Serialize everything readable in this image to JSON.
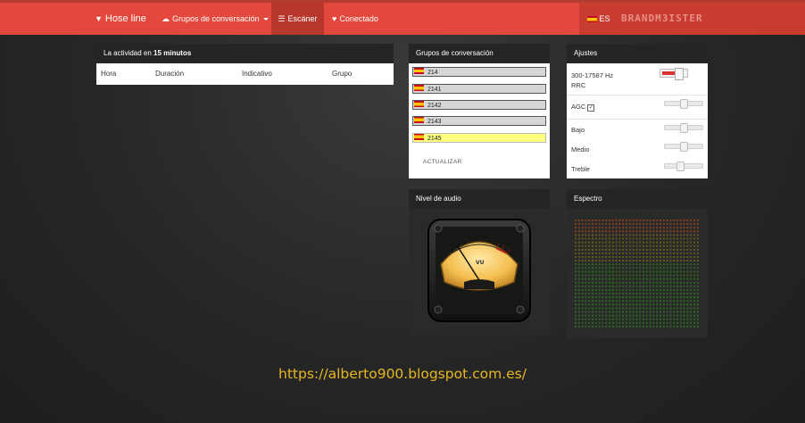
{
  "nav": {
    "brand": "Hose line",
    "groups_menu": "Grupos de conversación",
    "scanner": "Escáner",
    "connected": "Conectado",
    "language": "ES",
    "logo_text": "BRANDM3ISTER",
    "accent_color": "#e2483b",
    "icons": {
      "brand": "wifi-tower-icon",
      "groups": "cloud-icon",
      "scanner": "list-icon",
      "connected": "heart-icon"
    }
  },
  "activity": {
    "title_prefix": "La actividad en ",
    "title_bold": "15 minutos",
    "columns": [
      "Hora",
      "Duración",
      "Indicativo",
      "Grupo"
    ]
  },
  "groups": {
    "title": "Grupos de conversación",
    "items": [
      {
        "id": "214",
        "selected": false
      },
      {
        "id": "2141",
        "selected": false
      },
      {
        "id": "2142",
        "selected": false
      },
      {
        "id": "2143",
        "selected": false
      },
      {
        "id": "2145",
        "selected": true
      }
    ],
    "refresh_label": "ACTUALIZAR"
  },
  "settings": {
    "title": "Ajustes",
    "filter_label": "300-17587 Hz",
    "rrc_label": "RRC",
    "filter_on": true,
    "agc_label": "AGC",
    "agc_checked": true,
    "bass_label": "Bajo",
    "mid_label": "Medio",
    "treble_label": "Treble",
    "levels": {
      "agc": 0.5,
      "bass": 0.5,
      "mid": 0.5,
      "treble": 0.4
    }
  },
  "audio": {
    "title": "Nivel de audio",
    "meter_label": "VU",
    "scale_labels": [
      "20",
      "10",
      "7",
      "5",
      "3",
      "1",
      "0",
      "1",
      "2",
      "3"
    ]
  },
  "spectrum": {
    "title": "Espectro"
  },
  "footer": {
    "link_text": "https://alberto900.blogspot.com.es/"
  }
}
